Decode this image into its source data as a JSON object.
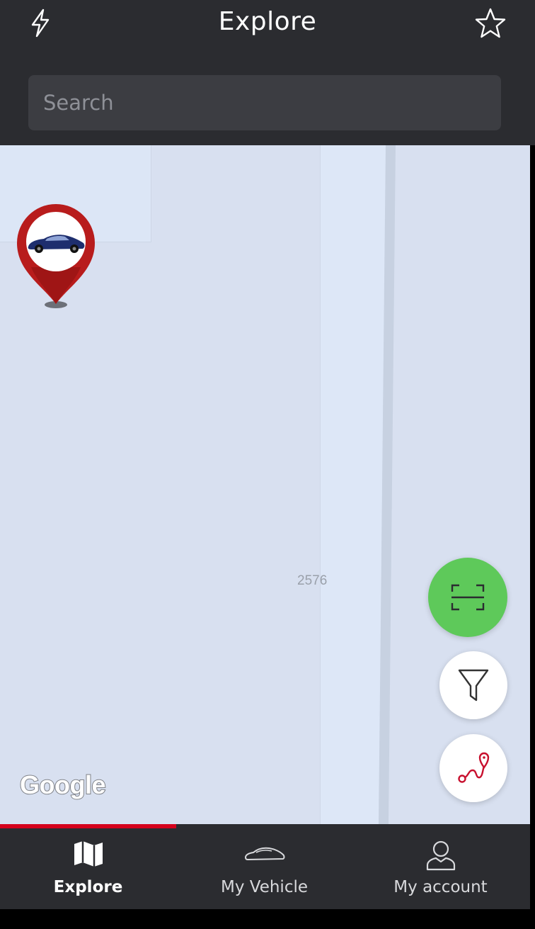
{
  "header": {
    "title": "Explore",
    "left_icon": "lightning-bolt-icon",
    "right_icon": "star-icon"
  },
  "search": {
    "placeholder": "Search",
    "value": ""
  },
  "map": {
    "road_label": "2576",
    "attribution": "Google",
    "pin_icon": "vehicle-location-pin-icon",
    "buttons": [
      "scan-icon",
      "filter-icon",
      "route-icon"
    ]
  },
  "tabs": [
    {
      "label": "Explore",
      "icon": "map-icon",
      "active": true
    },
    {
      "label": "My Vehicle",
      "icon": "car-icon",
      "active": false
    },
    {
      "label": "My account",
      "icon": "person-icon",
      "active": false
    }
  ],
  "colors": {
    "header_bg": "#2b2c30",
    "accent_red": "#d5001c",
    "scan_green": "#5ec95a",
    "map_bg": "#d8e0f0"
  }
}
